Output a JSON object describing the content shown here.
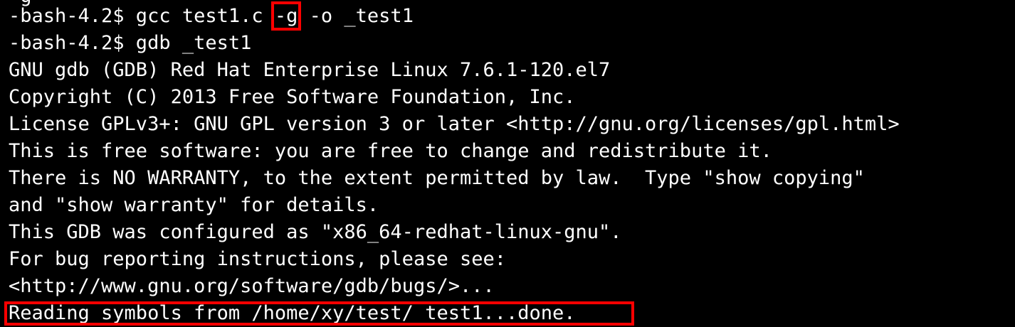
{
  "terminal": {
    "partial_top": "-g",
    "line1": {
      "before": "-bash-4.2$ gcc test1.c ",
      "flag": "-g",
      "after": " -o _test1"
    },
    "line2": "-bash-4.2$ gdb _test1",
    "line3": "GNU gdb (GDB) Red Hat Enterprise Linux 7.6.1-120.el7",
    "line4": "Copyright (C) 2013 Free Software Foundation, Inc.",
    "line5": "License GPLv3+: GNU GPL version 3 or later <http://gnu.org/licenses/gpl.html>",
    "line6": "This is free software: you are free to change and redistribute it.",
    "line7": "There is NO WARRANTY, to the extent permitted by law.  Type \"show copying\"",
    "line8": "and \"show warranty\" for details.",
    "line9": "This GDB was configured as \"x86_64-redhat-linux-gnu\".",
    "line10": "For bug reporting instructions, please see:",
    "line11": "<http://www.gnu.org/software/gdb/bugs/>...",
    "line12": "Reading symbols from /home/xy/test/_test1...done."
  },
  "colors": {
    "background": "#000000",
    "text": "#ffffff",
    "highlight": "#ff0000"
  }
}
